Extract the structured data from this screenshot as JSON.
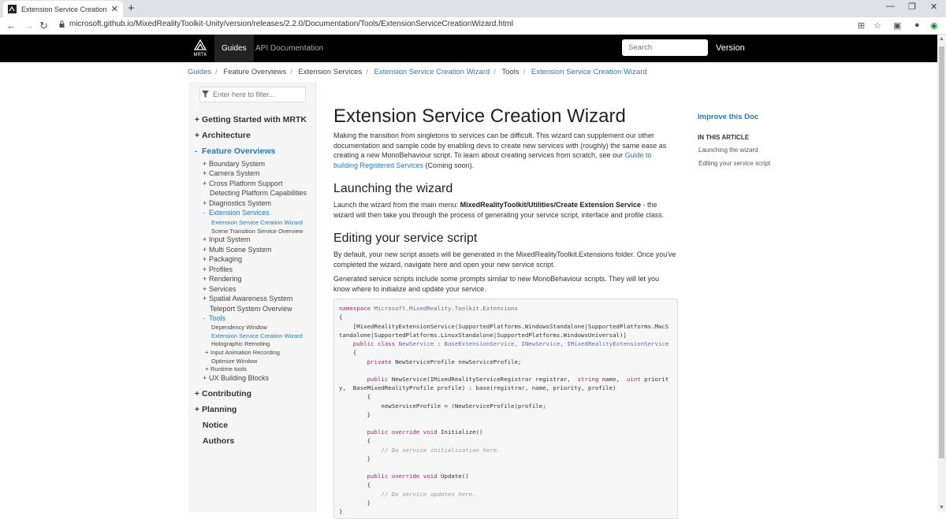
{
  "browser": {
    "tab_title": "Extension Service Creation Wizar",
    "url": "microsoft.github.io/MixedRealityToolkit-Unity/version/releases/2.2.0/Documentation/Tools/ExtensionServiceCreationWizard.html"
  },
  "navbar": {
    "logo_text": "MRTK",
    "guides": "Guides",
    "api": "API Documentation",
    "search_placeholder": "Search",
    "version": "Version"
  },
  "breadcrumb": {
    "items": [
      "Guides",
      "Feature Overviews",
      "Extension Services",
      "Extension Service Creation Wizard",
      "Tools",
      "Extension Service Creation Wizard"
    ]
  },
  "sidebar": {
    "filter_placeholder": "Enter here to filter...",
    "top": [
      "Getting Started with MRTK",
      "Architecture",
      "Feature Overviews"
    ],
    "features": [
      "Boundary System",
      "Camera System",
      "Cross Platform Support",
      "Detecting Platform Capabilities",
      "Diagnostics System",
      "Extension Services"
    ],
    "ext_children": [
      "Extension Service Creation Wizard",
      "Scene Transition Service Overview"
    ],
    "features2": [
      "Input System",
      "Multi Scene System",
      "Packaging",
      "Profiles",
      "Rendering",
      "Services",
      "Spatial Awareness System",
      "Teleport System Overview",
      "Tools"
    ],
    "tools_children": [
      "Dependency Window",
      "Extension Service Creation Wizard",
      "Holographic Remoting",
      "Input Animation Recording",
      "Optimize Window",
      "Runtime tools"
    ],
    "features3": [
      "UX Building Blocks"
    ],
    "bottom": [
      "Contributing",
      "Planning",
      "Notice",
      "Authors"
    ]
  },
  "article": {
    "title": "Extension Service Creation Wizard",
    "intro": "Making the transition from singletons to services can be difficult. This wizard can supplement our other documentation and sample code by enabling devs to create new services with (roughly) the same ease as creating a new MonoBehaviour script. To learn about creating services from scratch, see our ",
    "intro_link": "Guide to building Registered Services",
    "intro_tail": " (Coming soon).",
    "h_launch": "Launching the wizard",
    "launch_pre": "Launch the wizard from the main menu: ",
    "launch_bold": "MixedRealityToolkit/Utilities/Create Extension Service",
    "launch_post": " - the wizard will then take you through the process of generating your service script, interface and profile class.",
    "h_edit": "Editing your service script",
    "edit_p1": "By default, your new script assets will be generated in the MixedRealityToolkit.Extensions folder. Once you've completed the wizard, navigate here and open your new service script.",
    "edit_p2": "Generated service scripts include some prompts similar to new MonoBehaviour scripts. They will let you know where to initialize and update your service."
  },
  "code": {
    "ns_kw": "namespace",
    "ns": "Microsoft.MixedReality.Toolkit.Extensions",
    "l_brace": "{",
    "r_brace": "}",
    "attr1": "    [MixedRealityExtensionService(SupportedPlatforms.WindowsStandalone|SupportedPlatforms.MacS",
    "attr2": "tandalone|SupportedPlatforms.LinuxStandalone|SupportedPlatforms.WindowsUniversal)]",
    "class_pre": "    public class ",
    "class_name": "NewService",
    "class_mid": " : ",
    "class_bases": "BaseExtensionService, INewService, IMixedRealityExtensionService",
    "brace1": "    {",
    "field_kw": "        private ",
    "field": "NewServiceProfile newServiceProfile;",
    "ctor_kw": "        public ",
    "ctor1": "NewService(IMixedRealityServiceRegistrar registrar,  ",
    "ctor_s": "string",
    "ctor_n": " name,  ",
    "ctor_u": "uint",
    "ctor_p": " priorit",
    "ctor2": "y,  BaseMixedRealityProfile profile) : base(registrar, name, priority, profile)",
    "brace2": "        {",
    "assign": "            newServiceProfile = (NewServiceProfile)profile;",
    "rbrace2": "        }",
    "init_kw": "        public override void ",
    "init": "Initialize()",
    "init_cm": "            // Do service initialization here.",
    "upd_kw": "        public override void ",
    "upd": "Update()",
    "upd_cm": "            // Do service updates here."
  },
  "affix": {
    "improve": "Improve this Doc",
    "heading": "IN THIS ARTICLE",
    "links": [
      "Launching the wizard",
      "Editing your service script"
    ]
  }
}
